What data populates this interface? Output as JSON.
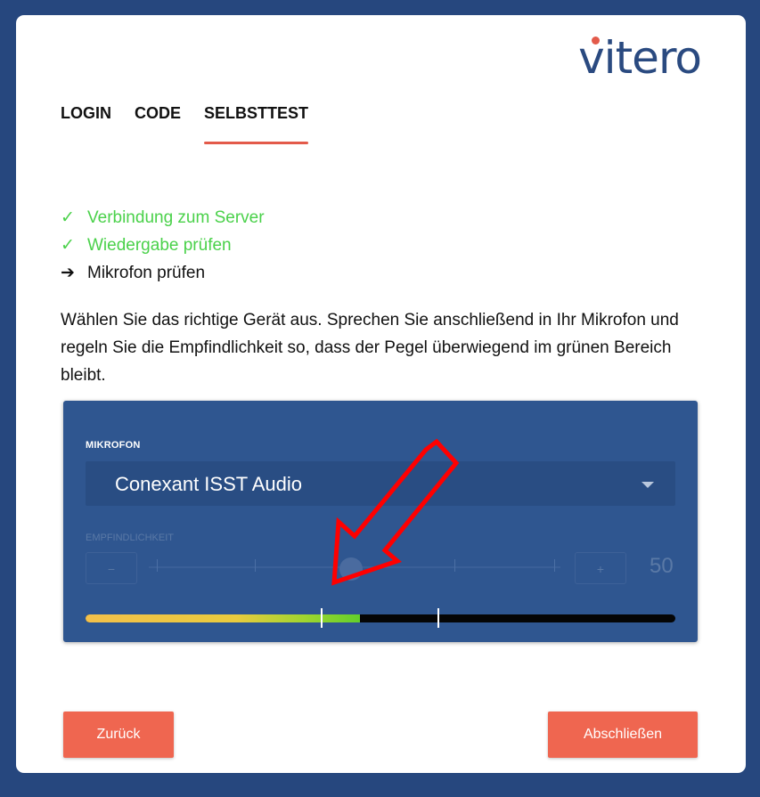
{
  "brand": {
    "logo_text": "vitero",
    "dot_color": "#e35a4a"
  },
  "tabs": [
    {
      "label": "LOGIN",
      "active": false
    },
    {
      "label": "CODE",
      "active": false
    },
    {
      "label": "SELBSTTEST",
      "active": true
    }
  ],
  "steps": [
    {
      "icon": "check-icon",
      "symbol": "✓",
      "label": "Verbindung zum Server",
      "status": "done"
    },
    {
      "icon": "check-icon",
      "symbol": "✓",
      "label": "Wiedergabe prüfen",
      "status": "done"
    },
    {
      "icon": "arrow-right-icon",
      "symbol": "➔",
      "label": "Mikrofon prüfen",
      "status": "current"
    }
  ],
  "instructions": "Wählen Sie das richtige Gerät aus. Sprechen Sie anschließend in Ihr Mikrofon und regeln Sie die Empfindlichkeit so, dass der Pegel überwiegend im grünen Bereich bleibt.",
  "microphone": {
    "label": "MIKROFON",
    "selected": "Conexant ISST Audio"
  },
  "sensitivity": {
    "label": "EMPFINDLICHKEIT",
    "decrement": "−",
    "increment": "+",
    "value": "50",
    "level_fraction": 0.5
  },
  "level_meter": {
    "fill_fraction": 0.465
  },
  "buttons": {
    "back": "Zurück",
    "finish": "Abschließen"
  },
  "colors": {
    "accent": "#ef6650",
    "ok": "#4ad14a",
    "panel": "#2f5690",
    "background": "#26477e",
    "annotation_arrow": "#ff0000"
  }
}
